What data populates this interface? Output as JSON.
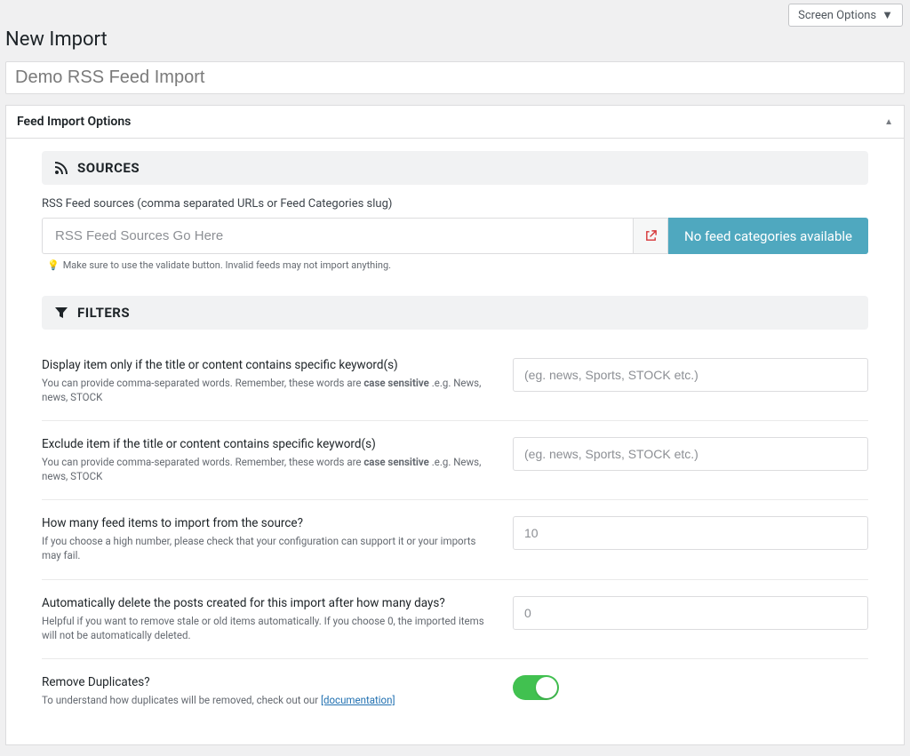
{
  "topbar": {
    "screen_options": "Screen Options"
  },
  "page": {
    "title": "New Import",
    "import_name": "Demo RSS Feed Import"
  },
  "postbox": {
    "header": "Feed Import Options"
  },
  "sources": {
    "heading": "SOURCES",
    "label": "RSS Feed sources (comma separated URLs or Feed Categories slug)",
    "placeholder": "RSS Feed Sources Go Here",
    "no_categories": "No feed categories available",
    "hint": "Make sure to use the validate button. Invalid feeds may not import anything."
  },
  "filters": {
    "heading": "FILTERS",
    "include": {
      "label": "Display item only if the title or content contains specific keyword(s)",
      "sub_pre": "You can provide comma-separated words. Remember, these words are ",
      "sub_bold": "case sensitive",
      "sub_post": " .e.g. News, news, STOCK",
      "placeholder": "(eg. news, Sports, STOCK etc.)"
    },
    "exclude": {
      "label": "Exclude item if the title or content contains specific keyword(s)",
      "sub_pre": "You can provide comma-separated words. Remember, these words are ",
      "sub_bold": "case sensitive",
      "sub_post": " .e.g. News, news, STOCK",
      "placeholder": "(eg. news, Sports, STOCK etc.)"
    },
    "count": {
      "label": "How many feed items to import from the source?",
      "sub": "If you choose a high number, please check that your configuration can support it or your imports may fail.",
      "value": "10"
    },
    "autodelete": {
      "label": "Automatically delete the posts created for this import after how many days?",
      "sub": "Helpful if you want to remove stale or old items automatically. If you choose 0, the imported items will not be automatically deleted.",
      "value": "0"
    },
    "duplicates": {
      "label": "Remove Duplicates?",
      "sub_pre": "To understand how duplicates will be removed, check out our ",
      "doc_link": "[documentation]",
      "enabled": true
    }
  }
}
